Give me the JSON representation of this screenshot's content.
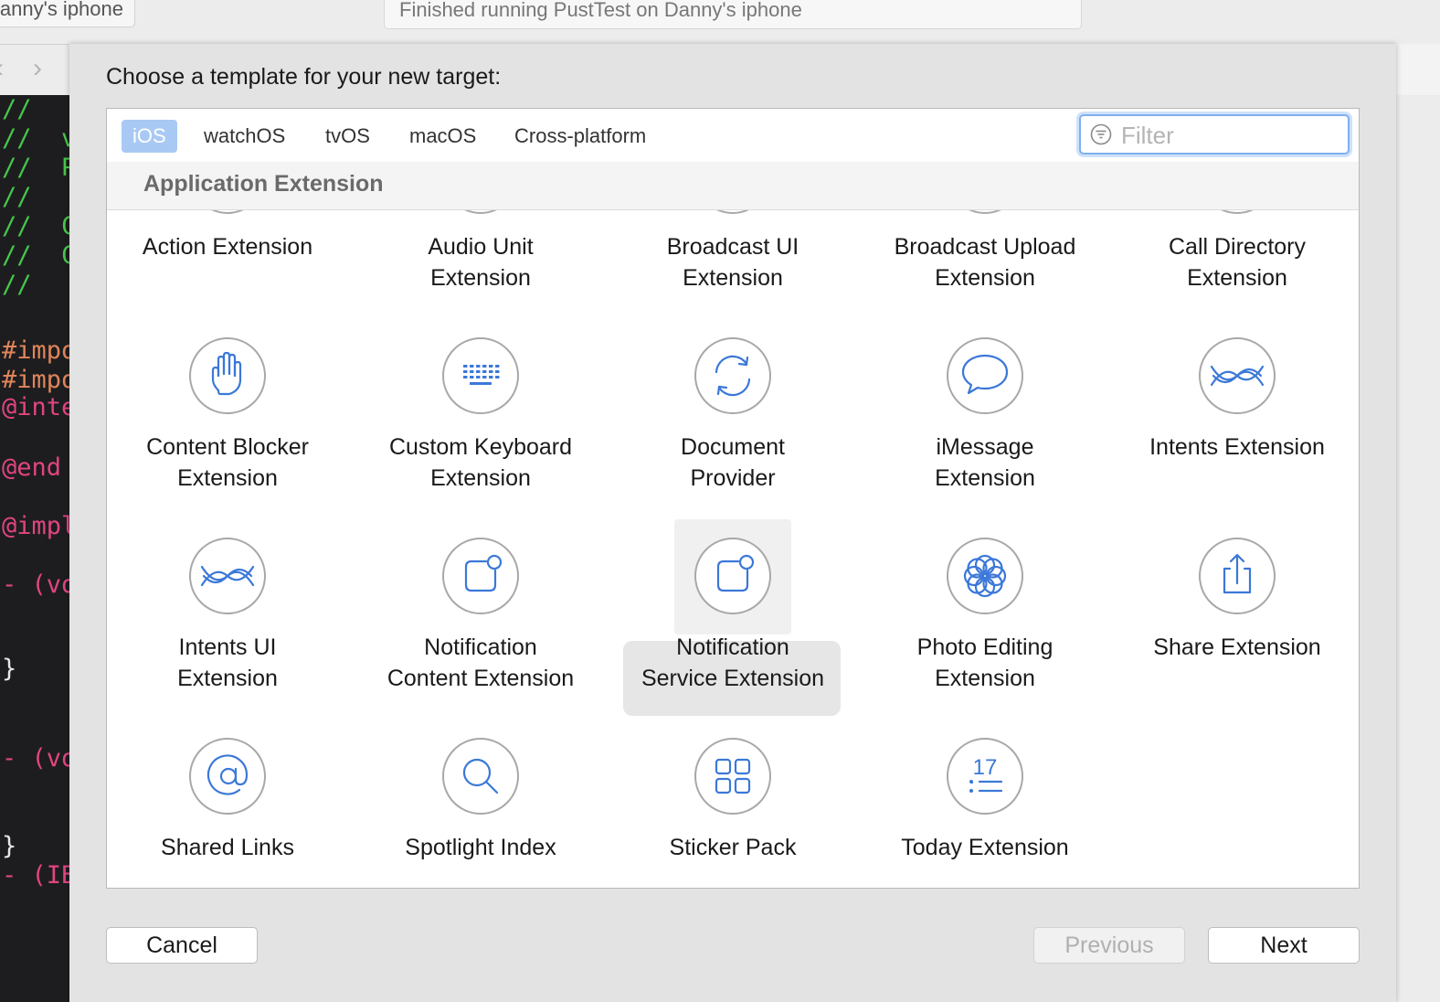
{
  "window": {
    "device_label": "anny's iphone",
    "status_text": "Finished running PustTest on Danny's iphone"
  },
  "nav": {
    "back": "‹",
    "forward": "›"
  },
  "code_lines": [
    {
      "text": "//",
      "cls": "c-green"
    },
    {
      "text": "//  v",
      "cls": "c-green"
    },
    {
      "text": "//  P",
      "cls": "c-green"
    },
    {
      "text": "//",
      "cls": "c-green"
    },
    {
      "text": "//  C",
      "cls": "c-green"
    },
    {
      "text": "//  C",
      "cls": "c-green"
    },
    {
      "text": "//",
      "cls": "c-green"
    },
    {
      "text": "",
      "cls": "c-white"
    },
    {
      "text": "#impo",
      "cls": "c-orange"
    },
    {
      "text": "#impo",
      "cls": "c-orange"
    },
    {
      "text": "@inte",
      "cls": "c-pink"
    },
    {
      "text": "",
      "cls": "c-white"
    },
    {
      "text": "@end",
      "cls": "c-pink"
    },
    {
      "text": "",
      "cls": "c-white"
    },
    {
      "text": "@impl",
      "cls": "c-pink"
    },
    {
      "text": "",
      "cls": "c-white"
    },
    {
      "text": "- (vo",
      "cls": "c-pink"
    },
    {
      "text": "",
      "cls": "c-white"
    },
    {
      "text": "",
      "cls": "c-white"
    },
    {
      "text": "}",
      "cls": "c-white"
    },
    {
      "text": "",
      "cls": "c-white"
    },
    {
      "text": "",
      "cls": "c-white"
    },
    {
      "text": "- (vo",
      "cls": "c-pink"
    },
    {
      "text": "",
      "cls": "c-white"
    },
    {
      "text": "",
      "cls": "c-white"
    },
    {
      "text": "}",
      "cls": "c-white"
    },
    {
      "text": "- (IB",
      "cls": "c-pink"
    }
  ],
  "sheet": {
    "title": "Choose a template for your new target:",
    "tabs": [
      {
        "label": "iOS",
        "active": true
      },
      {
        "label": "watchOS",
        "active": false
      },
      {
        "label": "tvOS",
        "active": false
      },
      {
        "label": "macOS",
        "active": false
      },
      {
        "label": "Cross-platform",
        "active": false
      }
    ],
    "filter": {
      "placeholder": "Filter",
      "value": ""
    },
    "section_title": "Application Extension",
    "templates": [
      {
        "label": "Action Extension",
        "icon": "gear-icon"
      },
      {
        "label": "Audio Unit\nExtension",
        "icon": "audio-wave-icon"
      },
      {
        "label": "Broadcast UI\nExtension",
        "icon": "layers-icon"
      },
      {
        "label": "Broadcast Upload\nExtension",
        "icon": "layers-icon"
      },
      {
        "label": "Call Directory\nExtension",
        "icon": "phone-icon"
      },
      {
        "label": "Content Blocker\nExtension",
        "icon": "hand-icon"
      },
      {
        "label": "Custom Keyboard\nExtension",
        "icon": "keyboard-icon"
      },
      {
        "label": "Document\nProvider",
        "icon": "sync-arrows-icon"
      },
      {
        "label": "iMessage\nExtension",
        "icon": "speech-bubble-icon"
      },
      {
        "label": "Intents Extension",
        "icon": "intents-wave-icon"
      },
      {
        "label": "Intents UI\nExtension",
        "icon": "intents-wave-icon"
      },
      {
        "label": "Notification\nContent Extension",
        "icon": "notification-badge-icon"
      },
      {
        "label": "Notification\nService Extension",
        "icon": "notification-badge-icon",
        "selected": true
      },
      {
        "label": "Photo Editing\nExtension",
        "icon": "flower-icon"
      },
      {
        "label": "Share Extension",
        "icon": "share-icon"
      },
      {
        "label": "Shared Links",
        "icon": "at-sign-icon"
      },
      {
        "label": "Spotlight Index",
        "icon": "magnifier-icon"
      },
      {
        "label": "Sticker Pack",
        "icon": "four-squares-icon"
      },
      {
        "label": "Today Extension",
        "icon": "calendar-list-icon"
      }
    ],
    "icon_badge_number": "17",
    "buttons": {
      "cancel": "Cancel",
      "previous": "Previous",
      "next": "Next"
    }
  },
  "colors": {
    "accent_blue": "#3b78d8",
    "tab_active_bg": "#a9c9f5",
    "code_green": "#46c74a",
    "code_pink": "#e0457f",
    "code_orange": "#e0855a"
  }
}
